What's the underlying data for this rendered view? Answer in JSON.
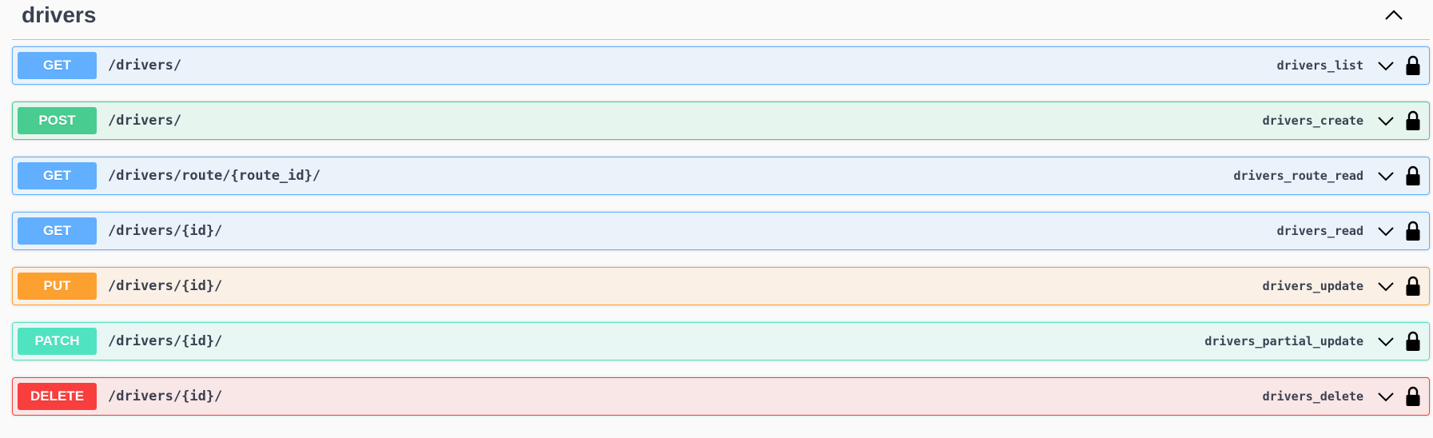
{
  "section": {
    "title": "drivers",
    "collapse_icon": "chevron-up-icon"
  },
  "operations": [
    {
      "method": "GET",
      "path": "/drivers/",
      "operation_id": "drivers_list",
      "type": "get"
    },
    {
      "method": "POST",
      "path": "/drivers/",
      "operation_id": "drivers_create",
      "type": "post"
    },
    {
      "method": "GET",
      "path": "/drivers/route/{route_id}/",
      "operation_id": "drivers_route_read",
      "type": "get"
    },
    {
      "method": "GET",
      "path": "/drivers/{id}/",
      "operation_id": "drivers_read",
      "type": "get"
    },
    {
      "method": "PUT",
      "path": "/drivers/{id}/",
      "operation_id": "drivers_update",
      "type": "put"
    },
    {
      "method": "PATCH",
      "path": "/drivers/{id}/",
      "operation_id": "drivers_partial_update",
      "type": "patch"
    },
    {
      "method": "DELETE",
      "path": "/drivers/{id}/",
      "operation_id": "drivers_delete",
      "type": "delete"
    }
  ],
  "colors": {
    "get": "#61affe",
    "post": "#49cc90",
    "put": "#fca130",
    "patch": "#50e3c2",
    "delete": "#f93e3e"
  }
}
